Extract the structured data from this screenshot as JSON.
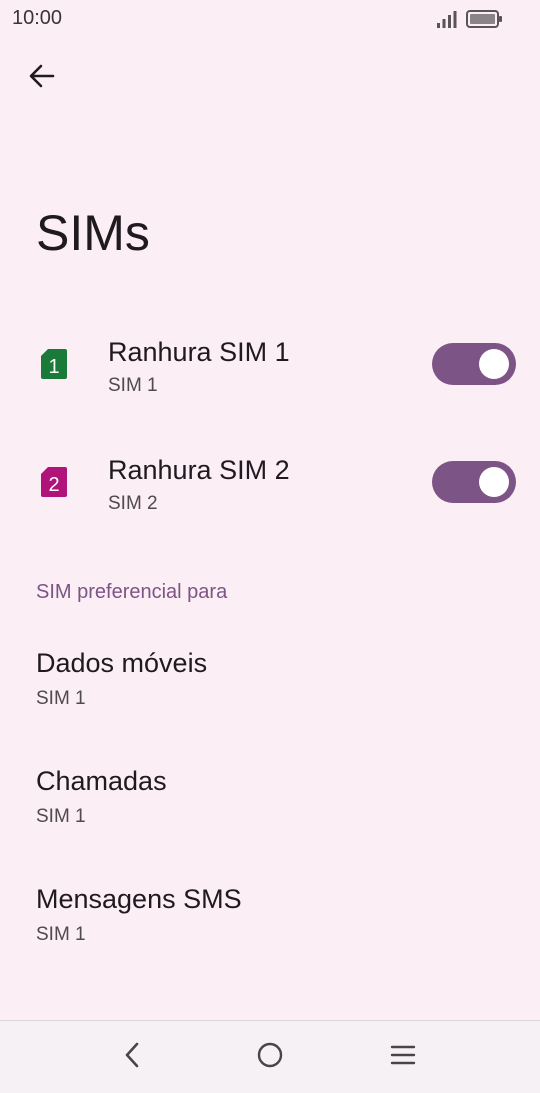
{
  "status": {
    "time": "10:00",
    "signal_icon": "signal-icon",
    "battery_icon": "battery-icon"
  },
  "header": {
    "back_icon": "arrow-left-icon",
    "title": "SIMs"
  },
  "sims": [
    {
      "slot_number": "1",
      "title": "Ranhura SIM 1",
      "subtitle": "SIM 1",
      "icon_color": "#1a7a3a",
      "enabled": true
    },
    {
      "slot_number": "2",
      "title": "Ranhura SIM 2",
      "subtitle": "SIM 2",
      "icon_color": "#b0147a",
      "enabled": true
    }
  ],
  "preferred_section": {
    "header": "SIM preferencial para",
    "items": [
      {
        "title": "Dados móveis",
        "value": "SIM 1"
      },
      {
        "title": "Chamadas",
        "value": "SIM 1"
      },
      {
        "title": "Mensagens SMS",
        "value": "SIM 1"
      }
    ]
  },
  "colors": {
    "background": "#fbeef4",
    "accent": "#7d5486",
    "toggle_knob": "#ffffff"
  },
  "nav": {
    "back_icon": "nav-back-icon",
    "home_icon": "nav-home-icon",
    "menu_icon": "nav-menu-icon"
  }
}
